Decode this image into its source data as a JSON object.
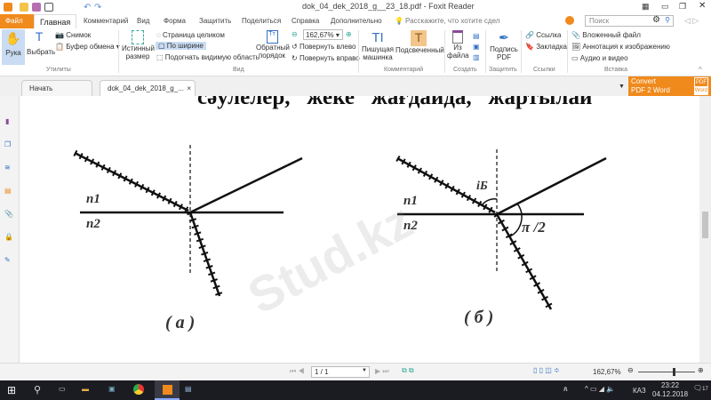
{
  "window": {
    "title": "dok_04_dek_2018_g__23_18.pdf - Foxit Reader"
  },
  "menu": {
    "tabs": [
      "Файл",
      "Главная",
      "Комментарий",
      "Вид",
      "Форма",
      "Защитить",
      "Поделиться",
      "Справка",
      "Дополнительно"
    ],
    "tell_me": "Расскажите, что хотите сдел",
    "search_placeholder": "Поиск"
  },
  "ribbon": {
    "hand": "Рука",
    "select": "Выбрать",
    "snapshot": "Снимок",
    "clipboard": "Буфер обмена",
    "group_utils": "Утилиты",
    "actual_size_1": "Истинный",
    "actual_size_2": "размер",
    "fit_page": "Страница целиком",
    "fit_width": "По ширине",
    "fit_visible": "Подогнать видимую область",
    "reverse_1": "Обратный",
    "reverse_2": "порядок",
    "zoom_value": "162,67%",
    "rotate_left": "Повернуть влево",
    "rotate_right": "Повернуть вправо",
    "group_view": "Вид",
    "typewriter_1": "Пишущая",
    "typewriter_2": "машинка",
    "highlight": "Подсвеченный",
    "group_comment": "Комментарий",
    "from_file_1": "Из",
    "from_file_2": "файла",
    "group_create": "Создать",
    "sign_1": "Подпись",
    "sign_2": "PDF",
    "group_protect": "Защитить",
    "link": "Ссылка",
    "bookmark": "Закладка",
    "group_links": "Ссылки",
    "attachment": "Вложенный файл",
    "image_annot": "Аннотация к изображению",
    "audio_video": "Аудио и видео",
    "group_insert": "Вставка"
  },
  "doc_tabs": [
    "Начать",
    "dok_04_dek_2018_g_..."
  ],
  "convert": {
    "line1": "Convert",
    "line2": "PDF 2 Word",
    "badge1": "PDF",
    "badge2": "Word"
  },
  "page": {
    "text_top": "сәулелер,   жеке   жағдайда,   жартылай",
    "n1": "n1",
    "n2": "n2",
    "label_a": "( а )",
    "label_b": "( б )",
    "angle_i": "iБ",
    "angle_pi": "π /2",
    "watermark": "Stud.kz"
  },
  "status": {
    "page": "1 / 1",
    "zoom": "162,67%",
    "zoom_fraction": 0.62
  },
  "taskbar": {
    "lang": "КАЗ",
    "time": "23:22",
    "date": "04.12.2018",
    "notif": "17"
  },
  "colors": {
    "accent": "#f08a1c",
    "select_bg": "#c9dcf3"
  }
}
